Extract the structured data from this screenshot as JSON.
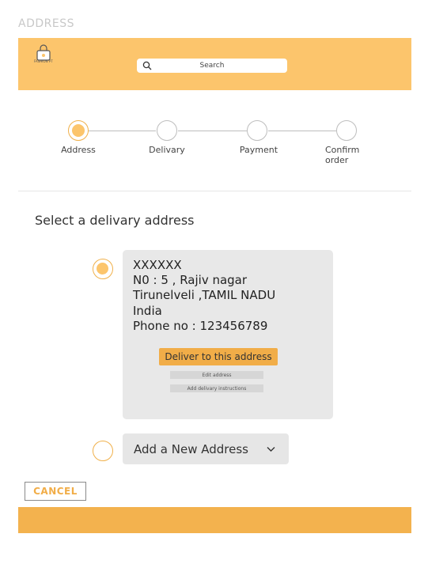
{
  "page": {
    "label": "ADDRESS"
  },
  "header": {
    "logo_text": "FASHION PT",
    "search": {
      "placeholder": "Search"
    }
  },
  "steps": [
    {
      "label": "Address",
      "active": true
    },
    {
      "label": "Delivary",
      "active": false
    },
    {
      "label": "Payment",
      "active": false
    },
    {
      "label": "Confirm order",
      "active": false
    }
  ],
  "main": {
    "title": "Select a delivary address",
    "selected_address": {
      "name": "XXXXXX",
      "line1": "N0 : 5 , Rajiv nagar",
      "line2": "Tirunelveli ,TAMIL NADU",
      "country": "India",
      "phone": "Phone no : 123456789"
    },
    "deliver_label": "Deliver to this address",
    "edit_label": "Edit address",
    "instructions_label": "Add delivary instructions",
    "new_address_label": "Add a New Address"
  },
  "actions": {
    "cancel_label": "CANCEL"
  },
  "colors": {
    "accent": "#fcc56c",
    "button": "#f1ad48",
    "footer": "#f3b24e"
  }
}
